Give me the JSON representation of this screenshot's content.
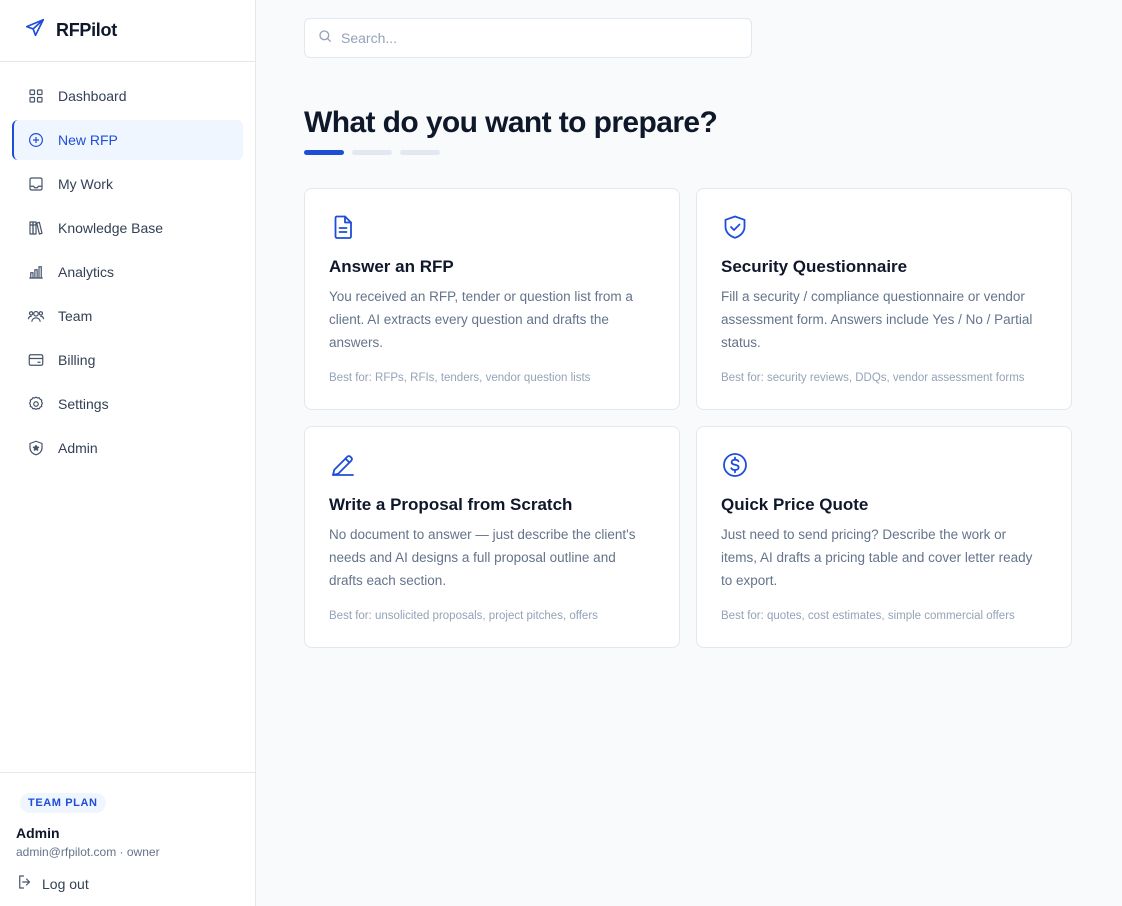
{
  "brand": {
    "name": "RFPilot",
    "icon": "paper-plane-icon"
  },
  "nav": {
    "items": [
      {
        "label": "Dashboard",
        "icon": "grid-icon",
        "active": false
      },
      {
        "label": "New RFP",
        "icon": "plus-circle-icon",
        "active": true
      },
      {
        "label": "My Work",
        "icon": "inbox-icon",
        "active": false
      },
      {
        "label": "Knowledge Base",
        "icon": "books-icon",
        "active": false
      },
      {
        "label": "Analytics",
        "icon": "bar-chart-icon",
        "active": false
      },
      {
        "label": "Team",
        "icon": "users-icon",
        "active": false
      },
      {
        "label": "Billing",
        "icon": "credit-card-icon",
        "active": false
      },
      {
        "label": "Settings",
        "icon": "gear-icon",
        "active": false
      },
      {
        "label": "Admin",
        "icon": "shield-star-icon",
        "active": false
      }
    ]
  },
  "footer": {
    "plan": "TEAM PLAN",
    "user_name": "Admin",
    "user_meta": "admin@rfpilot.com · owner",
    "logout": "Log out"
  },
  "search": {
    "placeholder": "Search...",
    "value": ""
  },
  "page": {
    "title": "What do you want to prepare?",
    "steps_total": 3,
    "current_step": 1
  },
  "cards": [
    {
      "icon": "document-icon",
      "title": "Answer an RFP",
      "description": "You received an RFP, tender or question list from a client. AI extracts every question and drafts the answers.",
      "best_for": "Best for: RFPs, RFIs, tenders, vendor question lists"
    },
    {
      "icon": "shield-check-icon",
      "title": "Security Questionnaire",
      "description": "Fill a security / compliance questionnaire or vendor assessment form. Answers include Yes / No / Partial status.",
      "best_for": "Best for: security reviews, DDQs, vendor assessment forms"
    },
    {
      "icon": "pencil-icon",
      "title": "Write a Proposal from Scratch",
      "description": "No document to answer — just describe the client's needs and AI designs a full proposal outline and drafts each section.",
      "best_for": "Best for: unsolicited proposals, project pitches, offers"
    },
    {
      "icon": "dollar-circle-icon",
      "title": "Quick Price Quote",
      "description": "Just need to send pricing? Describe the work or items, AI drafts a pricing table and cover letter ready to export.",
      "best_for": "Best for: quotes, cost estimates, simple commercial offers"
    }
  ],
  "colors": {
    "accent": "#1d4ed8",
    "accent_bg": "#eff6ff",
    "text": "#0f172a",
    "muted": "#64748b"
  }
}
